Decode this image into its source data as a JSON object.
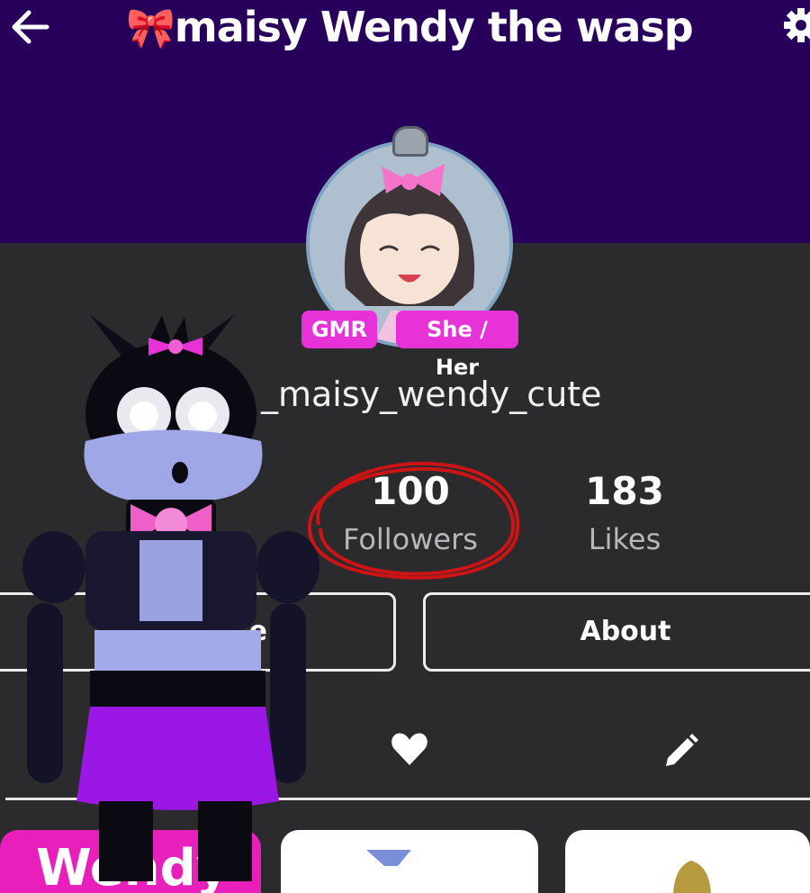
{
  "header": {
    "title_emoji": "🎀",
    "title": "maisy Wendy the wasp",
    "back_icon": "back-arrow-icon",
    "settings_icon": "gear-icon",
    "background": "#26005a"
  },
  "profile": {
    "badges": [
      "GMR",
      "She / Her"
    ],
    "username": "_maisy_wendy_cute"
  },
  "stats": {
    "followers": {
      "value": "100",
      "label": "Followers"
    },
    "likes": {
      "value": "183",
      "label": "Likes"
    }
  },
  "buttons": {
    "left_label_fragment": "e",
    "about_label": "About"
  },
  "tabs": {
    "likes_icon": "heart-icon",
    "edit_icon": "pencil-icon"
  },
  "cards": {
    "first_label": "Wendy"
  },
  "colors": {
    "accent": "#e632d6",
    "content_bg": "#2b2a2d",
    "annotation": "#cc1414"
  }
}
